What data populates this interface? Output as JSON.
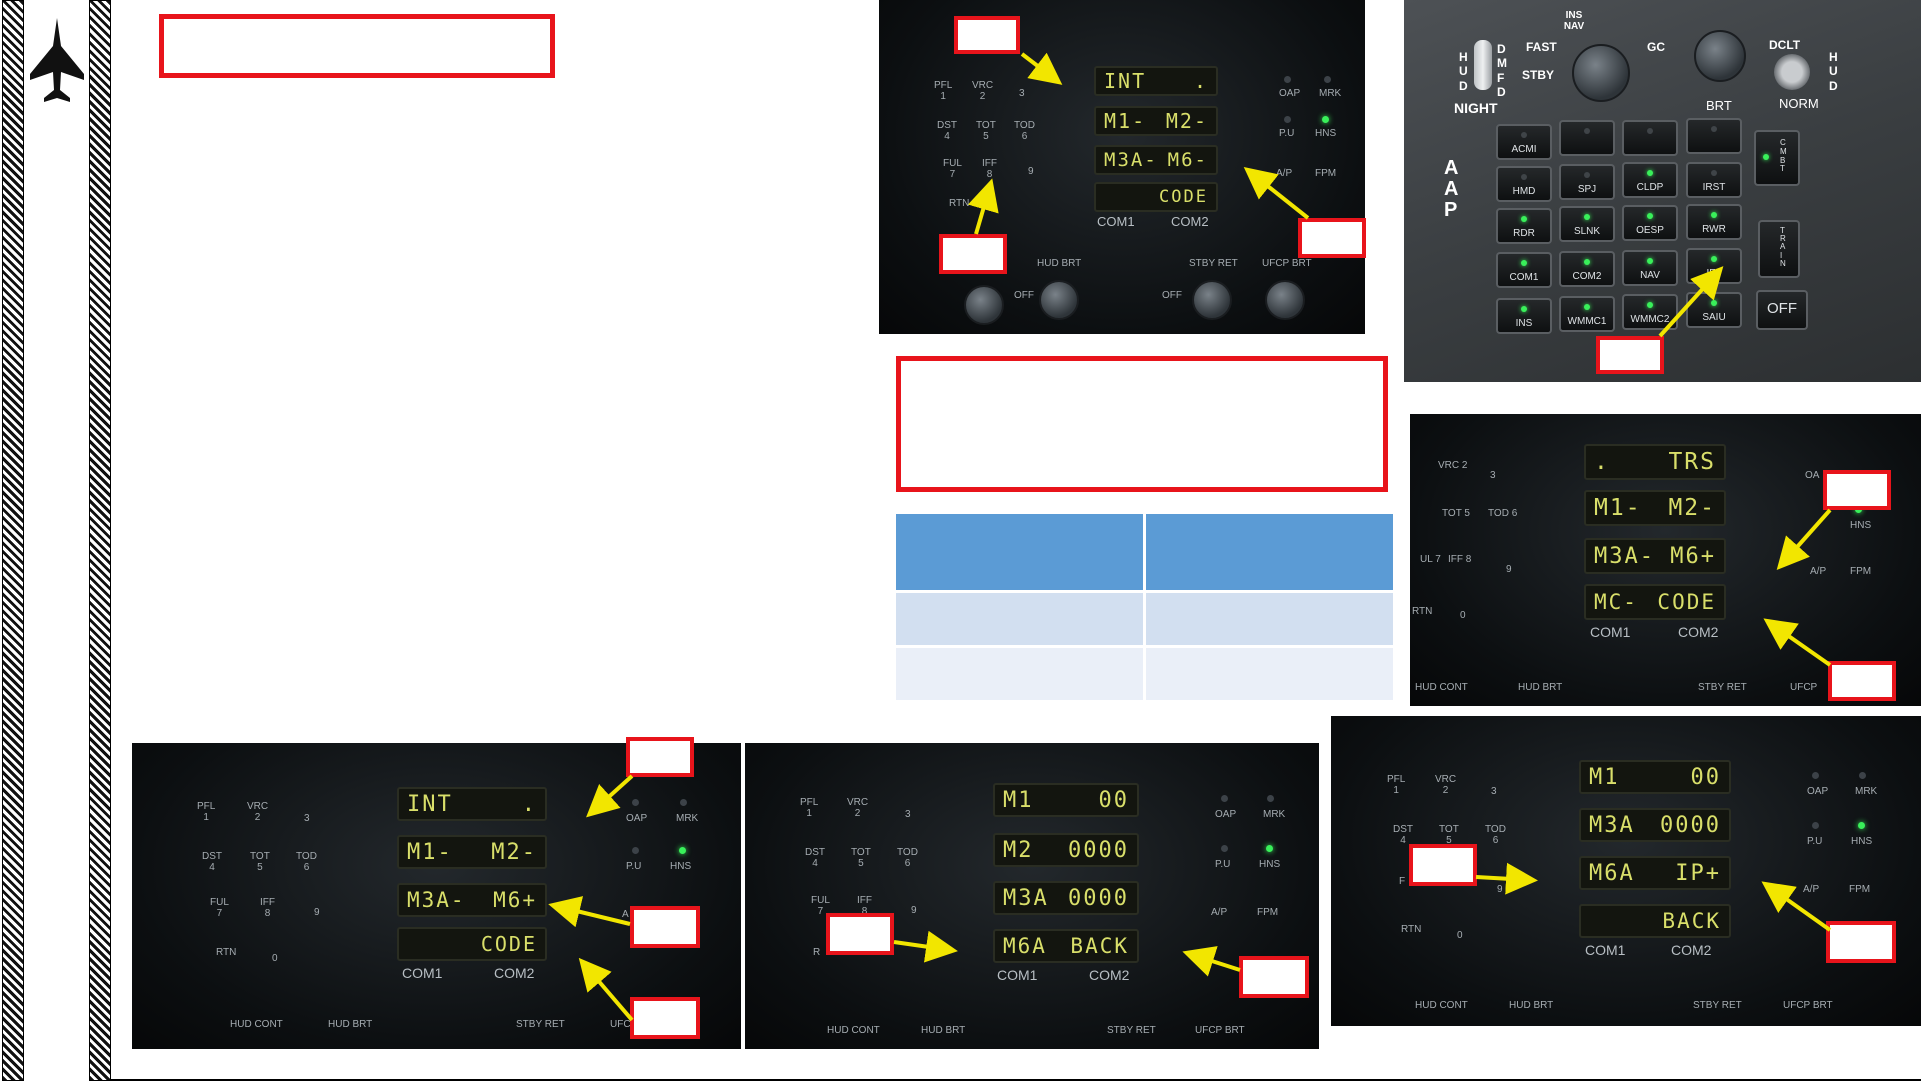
{
  "colors": {
    "callout_border": "#e8141b",
    "arrow": "#f2e600",
    "lcd_text": "#d9df6a",
    "led_on": "#39f05a",
    "table_header": "#5b9bd5",
    "table_row1": "#d2dff0",
    "table_row2": "#eaeff8"
  },
  "icons": {
    "sidebar": "fighter-jet-icon"
  },
  "ufcp_1": {
    "row1": [
      "INT",
      "."
    ],
    "row2": [
      "M1-",
      "M2-"
    ],
    "row3": [
      "M3A-",
      "M6-"
    ],
    "row4": [
      "",
      "CODE"
    ],
    "com": [
      "COM1",
      "COM2"
    ],
    "keys": [
      [
        "PFL",
        "1"
      ],
      [
        "VRC",
        "2"
      ],
      [
        "",
        "3"
      ],
      [
        "DST",
        "4"
      ],
      [
        "TOT",
        "5"
      ],
      [
        "TOD",
        "6"
      ],
      [
        "FUL",
        "7"
      ],
      [
        "IFF",
        "8"
      ],
      [
        "",
        "9"
      ],
      [
        "RTN",
        ""
      ],
      [
        "",
        "0"
      ]
    ],
    "right": [
      "OAP",
      "MRK",
      "P.U",
      "HNS",
      "A/P",
      "FPM"
    ],
    "knobs": [
      "HUD BRT",
      "STBY RET",
      "UFCP BRT",
      "OFF",
      "OFF"
    ]
  },
  "aap": {
    "toggle_hud": "H U D",
    "toggle_dmd": "D M F D",
    "night": "NIGHT",
    "insnav": "INS NAV",
    "fast": "FAST",
    "stby": "STBY",
    "gc": "GC",
    "brt": "BRT",
    "dclt": "DCLT",
    "hud_r": "H U D",
    "norm": "NORM",
    "aap_label": "A A P",
    "buttons": [
      "ACMI",
      "",
      "",
      "",
      "HMD",
      "SPJ",
      "CLDP",
      "IRST",
      "RDR",
      "SLNK",
      "OESP",
      "RWR",
      "COM1",
      "COM2",
      "NAV",
      "IFF",
      "INS",
      "WMMC1",
      "WMMC2",
      "SAIU"
    ],
    "cmbt": "C M B T",
    "train": "T R A I N",
    "off": "OFF"
  },
  "ufcp_right": {
    "row1": [
      ".",
      "TRS"
    ],
    "row2": [
      "M1-",
      "M2-"
    ],
    "row3": [
      "M3A-",
      "M6+"
    ],
    "row4": [
      "MC-",
      "CODE"
    ],
    "com": [
      "COM1",
      "COM2"
    ],
    "keys": [
      "VRC 2",
      "3",
      "TOT 5",
      "TOD 6",
      "UL 7",
      "IFF 8",
      "9",
      "RTN",
      "0"
    ],
    "right": [
      "OA",
      "HNS",
      "A/P",
      "FPM"
    ],
    "bottom": [
      "HUD CONT",
      "HUD BRT",
      "STBY RET",
      "UFCP"
    ]
  },
  "ufcp_b1": {
    "row1": [
      "INT",
      "."
    ],
    "row2": [
      "M1-",
      "M2-"
    ],
    "row3": [
      "M3A-",
      "M6+"
    ],
    "row4": [
      "",
      "CODE"
    ],
    "com": [
      "COM1",
      "COM2"
    ],
    "keys": [
      [
        "PFL",
        "1"
      ],
      [
        "VRC",
        "2"
      ],
      [
        "",
        "3"
      ],
      [
        "DST",
        "4"
      ],
      [
        "TOT",
        "5"
      ],
      [
        "TOD",
        "6"
      ],
      [
        "FUL",
        "7"
      ],
      [
        "IFF",
        "8"
      ],
      [
        "",
        "9"
      ],
      [
        "RTN",
        ""
      ],
      [
        "",
        "0"
      ]
    ],
    "right": [
      "OAP",
      "MRK",
      "P.U",
      "HNS",
      "A"
    ],
    "bottom": [
      "HUD CONT",
      "HUD BRT",
      "STBY RET",
      "UFC"
    ]
  },
  "ufcp_b2": {
    "row1": [
      "M1",
      "00"
    ],
    "row2": [
      "M2",
      "0000"
    ],
    "row3": [
      "M3A",
      "0000"
    ],
    "row4": [
      "M6A",
      "BACK"
    ],
    "com": [
      "COM1",
      "COM2"
    ],
    "keys": [
      [
        "PFL",
        "1"
      ],
      [
        "VRC",
        "2"
      ],
      [
        "",
        "3"
      ],
      [
        "DST",
        "4"
      ],
      [
        "TOT",
        "5"
      ],
      [
        "TOD",
        "6"
      ],
      [
        "FUL",
        "7"
      ],
      [
        "IFF",
        "8"
      ],
      [
        "",
        "9"
      ],
      [
        "R",
        ""
      ],
      [
        "",
        "0"
      ]
    ],
    "right": [
      "OAP",
      "MRK",
      "P.U",
      "HNS",
      "A/P",
      "FPM"
    ],
    "bottom": [
      "HUD CONT",
      "HUD BRT",
      "STBY RET",
      "UFCP BRT"
    ]
  },
  "ufcp_b3": {
    "row1": [
      "M1",
      "00"
    ],
    "row2": [
      "M3A",
      "0000"
    ],
    "row3": [
      "M6A",
      "IP+"
    ],
    "row4": [
      "",
      "BACK"
    ],
    "com": [
      "COM1",
      "COM2"
    ],
    "keys": [
      [
        "PFL",
        "1"
      ],
      [
        "VRC",
        "2"
      ],
      [
        "",
        "3"
      ],
      [
        "DST",
        "4"
      ],
      [
        "TOT",
        "5"
      ],
      [
        "TOD",
        "6"
      ],
      [
        "F",
        ""
      ],
      [
        "",
        "8"
      ],
      [
        "",
        "9"
      ],
      [
        "RTN",
        ""
      ],
      [
        "",
        "0"
      ]
    ],
    "right": [
      "OAP",
      "MRK",
      "P.U",
      "HNS",
      "A/P",
      "FPM"
    ],
    "bottom": [
      "HUD CONT",
      "HUD BRT",
      "STBY RET",
      "UFCP BRT"
    ]
  }
}
